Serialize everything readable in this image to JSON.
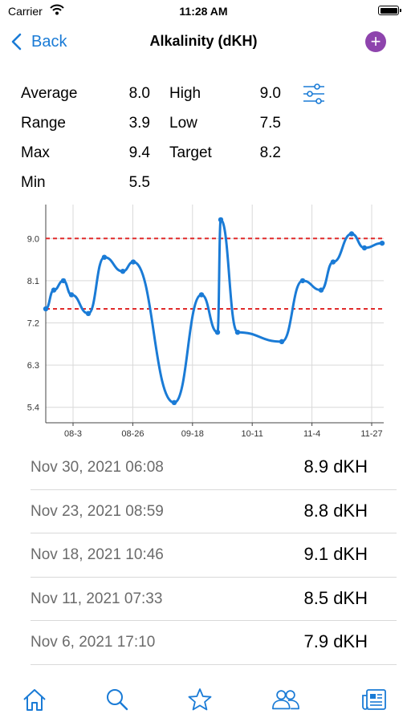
{
  "status_bar": {
    "carrier": "Carrier",
    "time": "11:28 AM"
  },
  "nav": {
    "back_label": "Back",
    "title": "Alkalinity (dKH)",
    "add_icon": "plus-circle-icon",
    "accent_color": "#1a7bd6",
    "add_color": "#8e44ad"
  },
  "stats": {
    "average_label": "Average",
    "average_value": "8.0",
    "high_label": "High",
    "high_value": "9.0",
    "range_label": "Range",
    "range_value": "3.9",
    "low_label": "Low",
    "low_value": "7.5",
    "max_label": "Max",
    "max_value": "9.4",
    "target_label": "Target",
    "target_value": "8.2",
    "min_label": "Min",
    "min_value": "5.5"
  },
  "chart_data": {
    "type": "line",
    "title": "",
    "xlabel": "",
    "ylabel": "",
    "x_tick_labels": [
      "08-3",
      "08-26",
      "09-18",
      "10-11",
      "11-4",
      "11-27"
    ],
    "y_tick_labels": [
      "9.0",
      "8.1",
      "7.2",
      "6.3",
      "5.4"
    ],
    "ylim": [
      5.4,
      9.0
    ],
    "grid": true,
    "reference_lines": [
      {
        "label": "High",
        "value": 9.0
      },
      {
        "label": "Low",
        "value": 7.5
      }
    ],
    "series": [
      {
        "color": "#1a7bd6",
        "values": [
          7.5,
          7.9,
          8.1,
          7.8,
          7.4,
          8.6,
          8.3,
          8.5,
          5.5,
          7.8,
          7.0,
          9.4,
          7.0,
          6.8,
          8.1,
          7.9,
          8.5,
          9.1,
          8.8,
          8.9
        ]
      }
    ],
    "reference_color": "#e02b2b"
  },
  "entries": [
    {
      "date": "Nov 30, 2021 06:08",
      "value": "8.9 dKH"
    },
    {
      "date": "Nov 23, 2021 08:59",
      "value": "8.8 dKH"
    },
    {
      "date": "Nov 18, 2021 10:46",
      "value": "9.1 dKH"
    },
    {
      "date": "Nov 11, 2021 07:33",
      "value": "8.5 dKH"
    },
    {
      "date": "Nov 6, 2021 17:10",
      "value": "7.9 dKH"
    }
  ],
  "tab_bar": {
    "icons": [
      "home-icon",
      "search-icon",
      "star-icon",
      "people-icon",
      "news-icon"
    ]
  }
}
